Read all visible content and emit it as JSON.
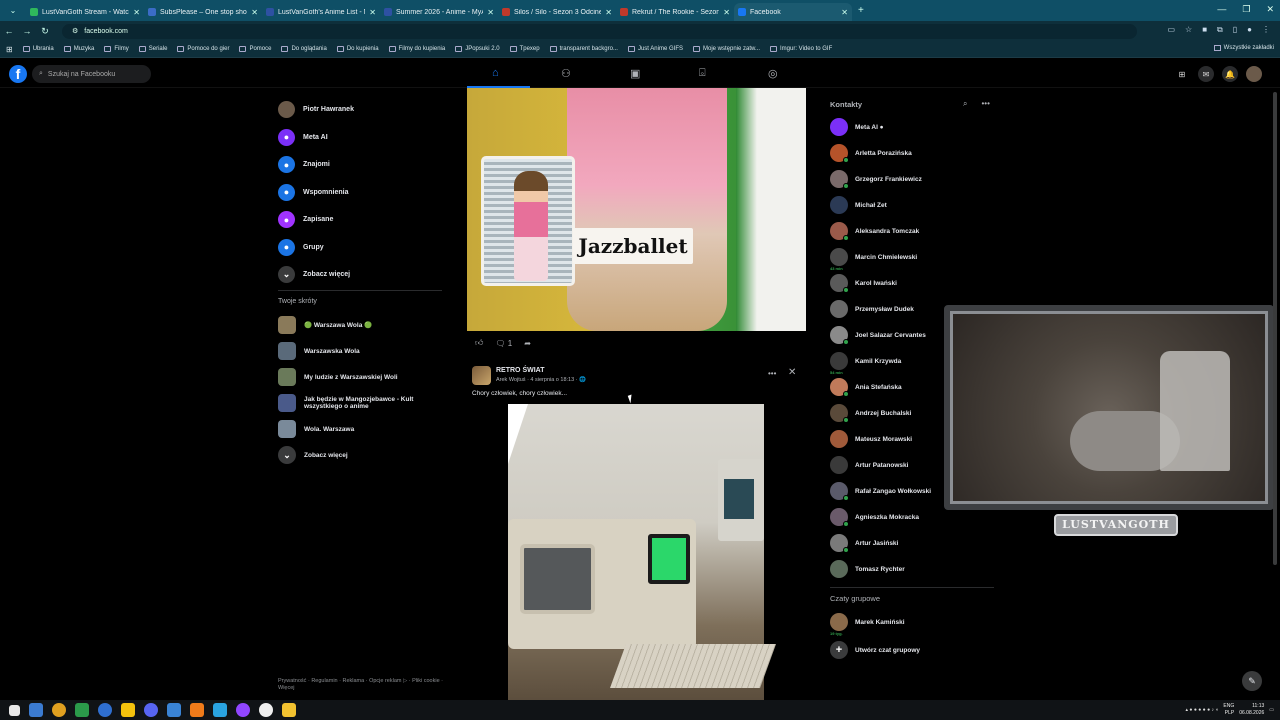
{
  "browser": {
    "tabs": [
      {
        "title": "LustVanGoth Stream - Watch L",
        "fav": "#2fb85c"
      },
      {
        "title": "SubsPlease – One stop shop fo",
        "fav": "#3b6cc6"
      },
      {
        "title": "LustVanGoth's Anime List - My",
        "fav": "#2e51a2"
      },
      {
        "title": "Summer 2026 - Anime - MyAn",
        "fav": "#2e51a2"
      },
      {
        "title": "Silos / Silo - Sezon 3 Odcinek 3",
        "fav": "#c0392b"
      },
      {
        "title": "Rekrut / The Rookie - Sezon 3",
        "fav": "#c0392b"
      },
      {
        "title": "Facebook",
        "fav": "#1877f2"
      }
    ],
    "url": "facebook.com",
    "bookmarks": [
      "Ubrania",
      "Muzyka",
      "Filmy",
      "Seriale",
      "Pomoce do gier",
      "Pomoce",
      "Do oglądania",
      "Do kupienia",
      "Filmy do kupienia",
      "JPopsuki 2.0",
      "Tpexep",
      "transparent backgro...",
      "Just Anime GIFS",
      "Moje wstępnie zatw...",
      "Imgur: Video to GIF"
    ],
    "bookmarks_right": "Wszystkie zakładki"
  },
  "fb": {
    "search_placeholder": "Szukaj na Facebooku",
    "left_nav": [
      {
        "label": "Piotr Hawranek",
        "icon": "avatar",
        "color": "#6b5a4a"
      },
      {
        "label": "Meta AI",
        "icon": "meta-ai-icon",
        "color": "#7b2ff7"
      },
      {
        "label": "Znajomi",
        "icon": "friends-icon",
        "color": "#1b74e4"
      },
      {
        "label": "Wspomnienia",
        "icon": "memories-icon",
        "color": "#1b74e4"
      },
      {
        "label": "Zapisane",
        "icon": "saved-icon",
        "color": "#a033ff"
      },
      {
        "label": "Grupy",
        "icon": "groups-icon",
        "color": "#1b74e4"
      },
      {
        "label": "Zobacz więcej",
        "icon": "chevron-down-icon",
        "color": "#3a3b3c"
      }
    ],
    "shortcuts_title": "Twoje skróty",
    "shortcuts": [
      {
        "label": "🟢 Warszawa Wola 🟢",
        "color": "#8a7a5a"
      },
      {
        "label": "Warszawska Wola",
        "color": "#5a6a7a"
      },
      {
        "label": "My ludzie z Warszawskiej Woli",
        "color": "#6a7a5a"
      },
      {
        "label": "Jak będzie w Mangozjebawce - Kult wszystkiego o anime",
        "color": "#4a5a8a"
      },
      {
        "label": "Wola. Warszawa",
        "color": "#7a8a9a"
      },
      {
        "label": "Zobacz więcej",
        "color": "#3a3b3c"
      }
    ],
    "footer": "Prywatność · Regulamin · Reklama · Opcje reklam ▷ · Pliki cookie · Więcej",
    "post1": {
      "image_text": "Jazzballet",
      "comments": "1"
    },
    "post2": {
      "author": "RETRO ŚWIAT",
      "meta": "Arek Wojtuś · 4 sierpnia o 18:13 · 🌐",
      "text": "Chory człowiek, chory człowiek..."
    },
    "contacts_title": "Kontakty",
    "contacts": [
      {
        "name": "Meta AI ●",
        "color": "#7b2ff7",
        "online": false,
        "ago": ""
      },
      {
        "name": "Arletta Porazińska",
        "color": "#b5532a",
        "online": true,
        "ago": ""
      },
      {
        "name": "Grzegorz Frankiewicz",
        "color": "#7a6a6a",
        "online": true,
        "ago": ""
      },
      {
        "name": "Michał Zet",
        "color": "#2b3a55",
        "online": false,
        "ago": ""
      },
      {
        "name": "Aleksandra Tomczak",
        "color": "#9a5a4a",
        "online": true,
        "ago": ""
      },
      {
        "name": "Marcin Chmielewski",
        "color": "#4a4a4a",
        "online": false,
        "ago": "43 min"
      },
      {
        "name": "Karol Iwański",
        "color": "#5a5a5a",
        "online": true,
        "ago": ""
      },
      {
        "name": "Przemysław Dudek",
        "color": "#6a6a6a",
        "online": false,
        "ago": ""
      },
      {
        "name": "Joel Salazar Cervantes",
        "color": "#8a8a8a",
        "online": true,
        "ago": ""
      },
      {
        "name": "Kamil Krzywda",
        "color": "#3a3a3a",
        "online": false,
        "ago": "54 min"
      },
      {
        "name": "Ania Stefańska",
        "color": "#c07a5a",
        "online": true,
        "ago": ""
      },
      {
        "name": "Andrzej Buchalski",
        "color": "#5a4a3a",
        "online": true,
        "ago": ""
      },
      {
        "name": "Mateusz Morawski",
        "color": "#a05a3a",
        "online": false,
        "ago": ""
      },
      {
        "name": "Artur Patanowski",
        "color": "#3a3a3a",
        "online": false,
        "ago": ""
      },
      {
        "name": "Rafał Zangao Wołkowski",
        "color": "#5a5a6a",
        "online": true,
        "ago": ""
      },
      {
        "name": "Agnieszka Mokracka",
        "color": "#6a5a6a",
        "online": true,
        "ago": ""
      },
      {
        "name": "Artur Jasiński",
        "color": "#7a7a7a",
        "online": true,
        "ago": ""
      },
      {
        "name": "Tomasz Rychter",
        "color": "#5a6a5a",
        "online": false,
        "ago": ""
      }
    ],
    "group_chats_title": "Czaty grupowe",
    "group_chats": [
      {
        "name": "Marek Kamiński",
        "color": "#8a6a4a",
        "ago": "19 tyg."
      },
      {
        "name": "Utwórz czat grupowy",
        "color": "#3a3b3c",
        "ago": ""
      }
    ]
  },
  "webcam_label": "LUSTVANGOTH",
  "taskbar": {
    "lang": "ENG",
    "lang2": "PLP",
    "time": "11:13",
    "date": "06.08.2026"
  }
}
